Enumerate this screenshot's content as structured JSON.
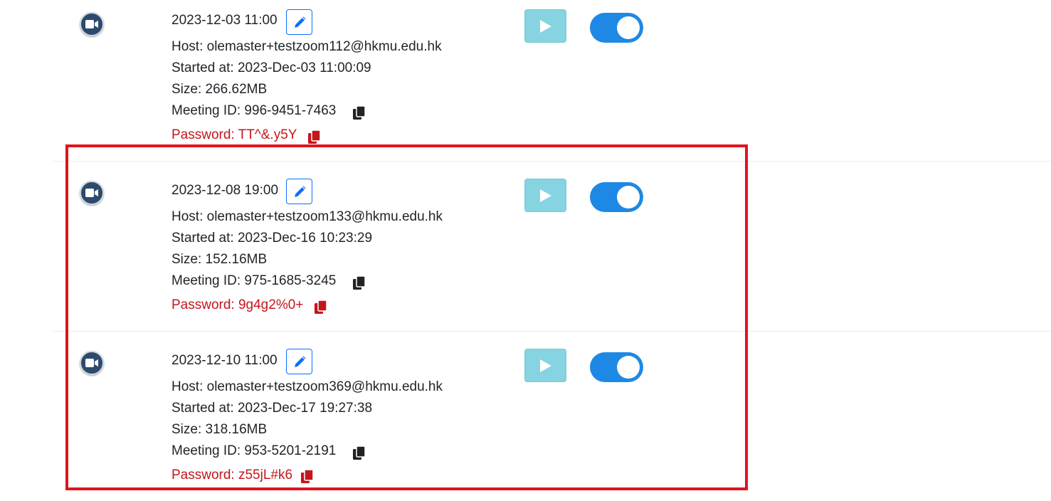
{
  "recordings": [
    {
      "date": "2023-12-03 11:00",
      "host": "Host: olemaster+testzoom112@hkmu.edu.hk",
      "started": "Started at: 2023-Dec-03 11:00:09",
      "size": "Size: 266.62MB",
      "meeting_id": "Meeting ID: 996-9451-7463",
      "password": "Password: TT^&.y5Y",
      "published": true
    },
    {
      "date": "2023-12-08 19:00",
      "host": "Host: olemaster+testzoom133@hkmu.edu.hk",
      "started": "Started at: 2023-Dec-16 10:23:29",
      "size": "Size: 152.16MB",
      "meeting_id": "Meeting ID: 975-1685-3245",
      "password": "Password: 9g4g2%0+",
      "published": true
    },
    {
      "date": "2023-12-10 11:00",
      "host": "Host: olemaster+testzoom369@hkmu.edu.hk",
      "started": "Started at: 2023-Dec-17 19:27:38",
      "size": "Size: 318.16MB",
      "meeting_id": "Meeting ID: 953-5201-2191",
      "password": "Password: z55jL#k6",
      "published": true
    }
  ],
  "colors": {
    "password_red": "#c4161c",
    "toggle_blue": "#1e88e5",
    "play_cyan": "#86d3e1",
    "highlight_red": "#e0141c"
  },
  "icons": {
    "row_icon": "zoom-camera-icon",
    "edit": "pencil-icon",
    "copy": "copy-icon",
    "play": "play-icon"
  }
}
